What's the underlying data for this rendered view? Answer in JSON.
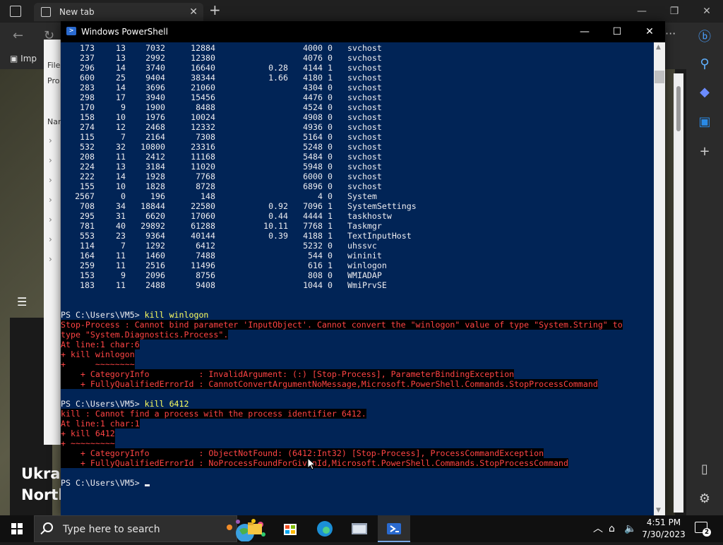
{
  "browser": {
    "tab_title": "New tab",
    "favorites_item": "Imp",
    "side_panel_labels": [
      "File",
      "Pro",
      "Nar"
    ],
    "news_headline": "Ukrai\nNorth"
  },
  "powershell": {
    "title": "Windows PowerShell",
    "process_rows": [
      [
        "173",
        "13",
        "7032",
        "12884",
        "",
        "4000",
        "0",
        "svchost"
      ],
      [
        "237",
        "13",
        "2992",
        "12380",
        "",
        "4076",
        "0",
        "svchost"
      ],
      [
        "296",
        "14",
        "3740",
        "16640",
        "0.28",
        "4144",
        "1",
        "svchost"
      ],
      [
        "600",
        "25",
        "9404",
        "38344",
        "1.66",
        "4180",
        "1",
        "svchost"
      ],
      [
        "283",
        "14",
        "3696",
        "21060",
        "",
        "4304",
        "0",
        "svchost"
      ],
      [
        "298",
        "17",
        "3940",
        "15456",
        "",
        "4476",
        "0",
        "svchost"
      ],
      [
        "170",
        "9",
        "1900",
        "8488",
        "",
        "4524",
        "0",
        "svchost"
      ],
      [
        "158",
        "10",
        "1976",
        "10024",
        "",
        "4908",
        "0",
        "svchost"
      ],
      [
        "274",
        "12",
        "2468",
        "12332",
        "",
        "4936",
        "0",
        "svchost"
      ],
      [
        "115",
        "7",
        "2164",
        "7308",
        "",
        "5164",
        "0",
        "svchost"
      ],
      [
        "532",
        "32",
        "10800",
        "23316",
        "",
        "5248",
        "0",
        "svchost"
      ],
      [
        "208",
        "11",
        "2412",
        "11168",
        "",
        "5484",
        "0",
        "svchost"
      ],
      [
        "224",
        "13",
        "3184",
        "11020",
        "",
        "5948",
        "0",
        "svchost"
      ],
      [
        "222",
        "14",
        "1928",
        "7768",
        "",
        "6000",
        "0",
        "svchost"
      ],
      [
        "155",
        "10",
        "1828",
        "8728",
        "",
        "6896",
        "0",
        "svchost"
      ],
      [
        "2567",
        "0",
        "196",
        "148",
        "",
        "4",
        "0",
        "System"
      ],
      [
        "708",
        "34",
        "18844",
        "22580",
        "0.92",
        "7096",
        "1",
        "SystemSettings"
      ],
      [
        "295",
        "31",
        "6620",
        "17060",
        "0.44",
        "4444",
        "1",
        "taskhostw"
      ],
      [
        "781",
        "40",
        "29892",
        "61288",
        "10.11",
        "7768",
        "1",
        "Taskmgr"
      ],
      [
        "553",
        "23",
        "9364",
        "40144",
        "0.39",
        "4188",
        "1",
        "TextInputHost"
      ],
      [
        "114",
        "7",
        "1292",
        "6412",
        "",
        "5232",
        "0",
        "uhssvc"
      ],
      [
        "164",
        "11",
        "1460",
        "7488",
        "",
        "544",
        "0",
        "wininit"
      ],
      [
        "259",
        "11",
        "2516",
        "11496",
        "",
        "616",
        "1",
        "winlogon"
      ],
      [
        "153",
        "9",
        "2096",
        "8756",
        "",
        "808",
        "0",
        "WMIADAP"
      ],
      [
        "183",
        "11",
        "2488",
        "9408",
        "",
        "1044",
        "0",
        "WmiPrvSE"
      ]
    ],
    "prompt": "PS C:\\Users\\VM5>",
    "cmd1": "kill winlogon",
    "error1": [
      "Stop-Process : Cannot bind parameter 'InputObject'. Cannot convert the \"winlogon\" value of type \"System.String\" to",
      "type \"System.Diagnostics.Process\".",
      "At line:1 char:6",
      "+ kill winlogon",
      "+      ~~~~~~~~",
      "    + CategoryInfo          : InvalidArgument: (:) [Stop-Process], ParameterBindingException",
      "    + FullyQualifiedErrorId : CannotConvertArgumentNoMessage,Microsoft.PowerShell.Commands.StopProcessCommand"
    ],
    "cmd2": "kill 6412",
    "error2": [
      "kill : Cannot find a process with the process identifier 6412.",
      "At line:1 char:1",
      "+ kill 6412",
      "+ ~~~~~~~~~",
      "    + CategoryInfo          : ObjectNotFound: (6412:Int32) [Stop-Process], ProcessCommandException",
      "    + FullyQualifiedErrorId : NoProcessFoundForGivenId,Microsoft.PowerShell.Commands.StopProcessCommand"
    ]
  },
  "taskbar": {
    "search_placeholder": "Type here to search",
    "time": "4:51 PM",
    "date": "7/30/2023",
    "notification_count": "2"
  },
  "colors": {
    "ps_background": "#012456",
    "ps_error_text": "#ff4444",
    "ps_command_text": "#ffff60"
  }
}
